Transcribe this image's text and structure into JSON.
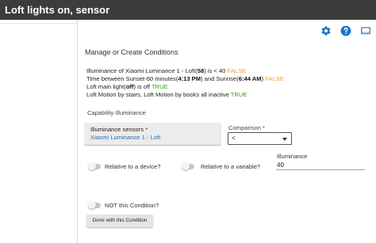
{
  "window": {
    "title": "Loft lights on, sensor"
  },
  "toolbar": {
    "icons": [
      "gear-icon",
      "help-icon",
      "screen-icon"
    ],
    "icon_color": "#1a73c8"
  },
  "conditions": {
    "heading": "Manage or Create Conditions",
    "lines": [
      {
        "pre": "Illuminance of Xiaomi Luminance 1 - Loft(",
        "bold1": "58",
        "mid": ") is < 40 ",
        "bold2": "",
        "post": "",
        "status": "FALSE"
      },
      {
        "pre": "Time between Sunset-60 minutes(",
        "bold1": "4:13 PM",
        "mid": ") and Sunrise(",
        "bold2": "6:44 AM",
        "post": ") ",
        "status": "FALSE"
      },
      {
        "pre": "Loft main light(",
        "bold1": "off",
        "mid": ") is off ",
        "bold2": "",
        "post": "",
        "status": "TRUE"
      },
      {
        "pre": "Loft Motion by stairs, Loft Motion by books all inactive ",
        "bold1": "",
        "mid": "",
        "bold2": "",
        "post": "",
        "status": "TRUE"
      }
    ],
    "status_colors": {
      "FALSE": "#f0a01e",
      "TRUE": "#3a9a18"
    }
  },
  "capability": {
    "label": "Capability Illuminance"
  },
  "sensors": {
    "label": "Illuminance sensors *",
    "value": "Xiaomi Luminance 1 - Loft"
  },
  "comparison": {
    "label": "Comparison *",
    "value": "<"
  },
  "toggles": {
    "relative_device": "Relative to a device?",
    "relative_variable": "Relative to a variable?",
    "not_condition": "NOT this Condition?"
  },
  "illuminance": {
    "label": "Illuminance",
    "value": "40"
  },
  "actions": {
    "done_label": "Done with this Condition"
  }
}
